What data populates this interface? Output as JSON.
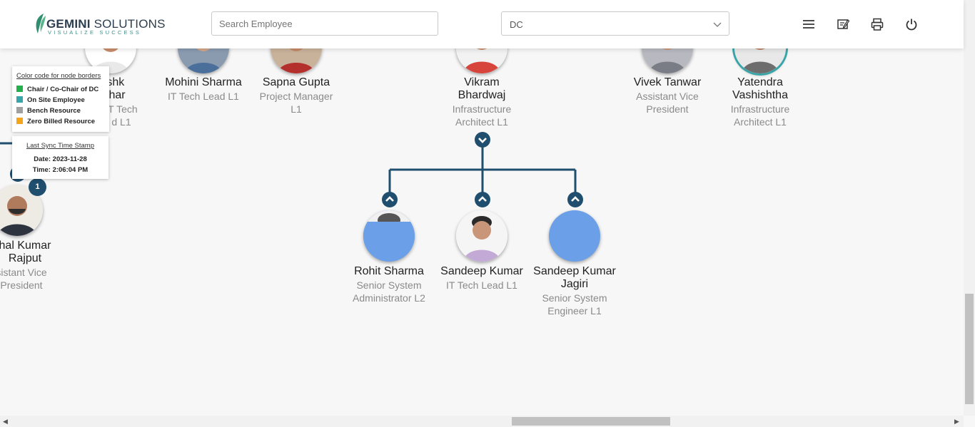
{
  "header": {
    "logo_name_bold": "GEMINI",
    "logo_name_light": "SOLUTIONS",
    "logo_tagline": "VISUALIZE SUCCESS",
    "search_placeholder": "Search Employee",
    "department_selected": "DC",
    "icons": [
      "menu-icon",
      "notes-icon",
      "print-icon",
      "power-icon"
    ]
  },
  "nodes": {
    "abhishek": {
      "name_line1": "ishk",
      "name_line2": "shar",
      "role_line1": "IT Tech",
      "role_line2": "d L1"
    },
    "mohini": {
      "name": "Mohini Sharma",
      "role": "IT Tech Lead L1"
    },
    "sapna": {
      "name": "Sapna Gupta",
      "role_line1": "Project Manager",
      "role_line2": "L1"
    },
    "vikram": {
      "name_line1": "Vikram",
      "name_line2": "Bhardwaj",
      "role_line1": "Infrastructure",
      "role_line2": "Architect L1"
    },
    "vivek": {
      "name": "Vivek Tanwar",
      "role_line1": "Assistant Vice",
      "role_line2": "President"
    },
    "yatendra": {
      "name_line1": "Yatendra",
      "name_line2": "Vashishtha",
      "role_line1": "Infrastructure",
      "role_line2": "Architect L1"
    },
    "vishal": {
      "name_line1": "hal Kumar",
      "name_line2": "Rajput",
      "role_line1": "sistant Vice",
      "role_line2": "President",
      "badge": "1"
    },
    "rohit": {
      "name": "Rohit Sharma",
      "role_line1": "Senior System",
      "role_line2": "Administrator L2"
    },
    "sandeep": {
      "name": "Sandeep Kumar",
      "role": "IT Tech Lead L1"
    },
    "sandeep_jagiri": {
      "name_line1": "Sandeep Kumar",
      "name_line2": "Jagiri",
      "role_line1": "Senior System",
      "role_line2": "Engineer L1"
    }
  },
  "legend": {
    "title": "Color code for node borders",
    "items": [
      {
        "label": "Chair / Co-Chair of DC",
        "color": "#22b14c"
      },
      {
        "label": "On Site Employee",
        "color": "#3aa5a8"
      },
      {
        "label": "Bench Resource",
        "color": "#a0a0a0"
      },
      {
        "label": "Zero Billed Resource",
        "color": "#f5a51b"
      }
    ]
  },
  "sync": {
    "title": "Last Sync Time Stamp",
    "date": "Date: 2023-11-28",
    "time": "Time: 2:06:04 PM"
  },
  "colors": {
    "accent": "#1f4e6e",
    "placeholder_avatar": "#6ba0e8"
  }
}
